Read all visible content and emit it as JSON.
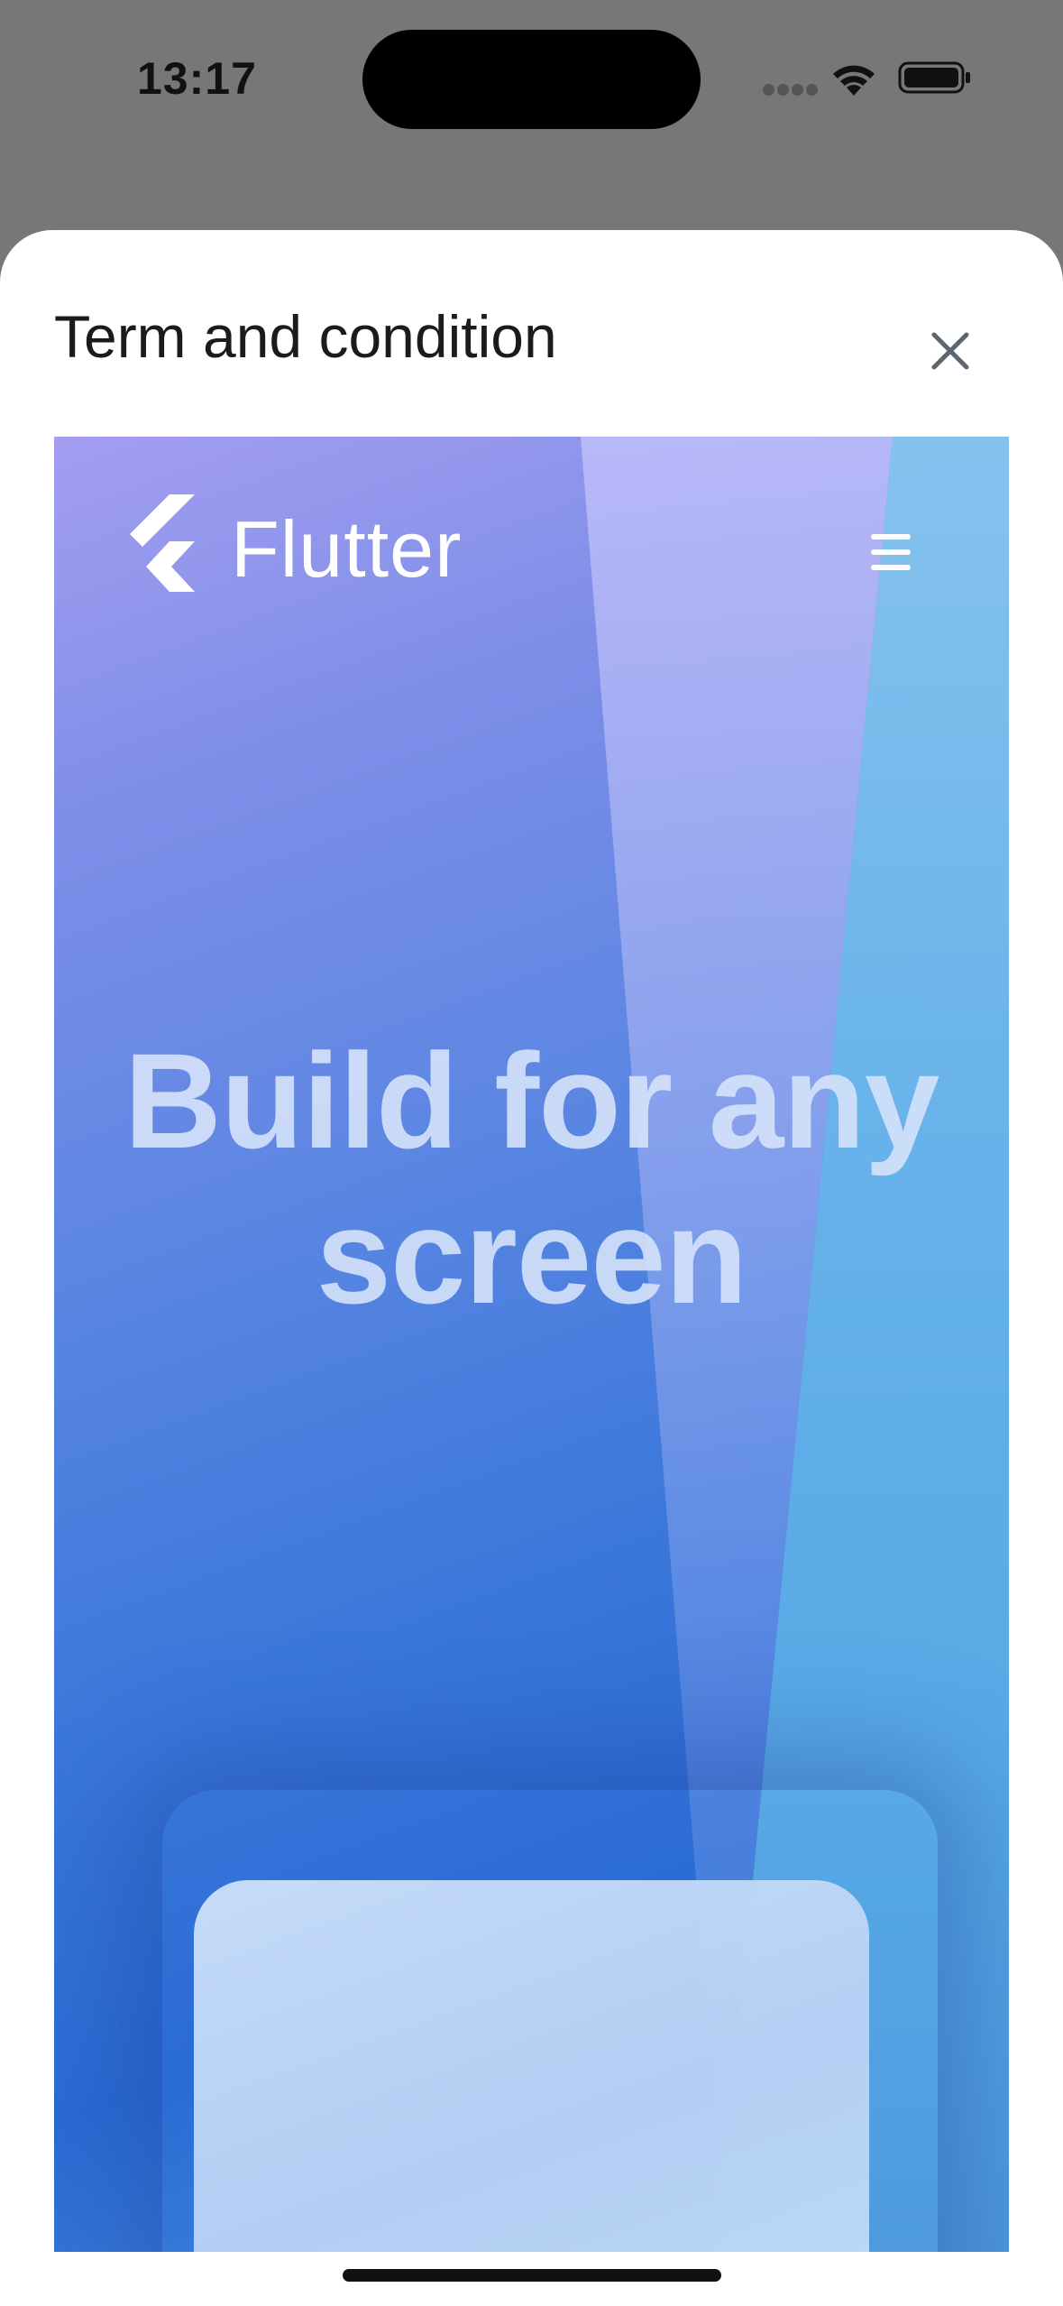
{
  "status_bar": {
    "time": "13:17",
    "icons": [
      "cellular-icon",
      "wifi-icon",
      "battery-icon"
    ]
  },
  "sheet": {
    "title": "Term and condition",
    "close_icon": "close-icon"
  },
  "web_content": {
    "logo_icon": "flutter-logo-icon",
    "brand": "Flutter",
    "menu_icon": "hamburger-menu-icon",
    "hero_title": "Build for any screen"
  },
  "colors": {
    "sheet_background": "#ffffff",
    "overlay": "#777777",
    "hero_gradient_start": "#a49ef0",
    "hero_gradient_end": "#2a6bd4",
    "hero_text": "#d2e1fa"
  }
}
